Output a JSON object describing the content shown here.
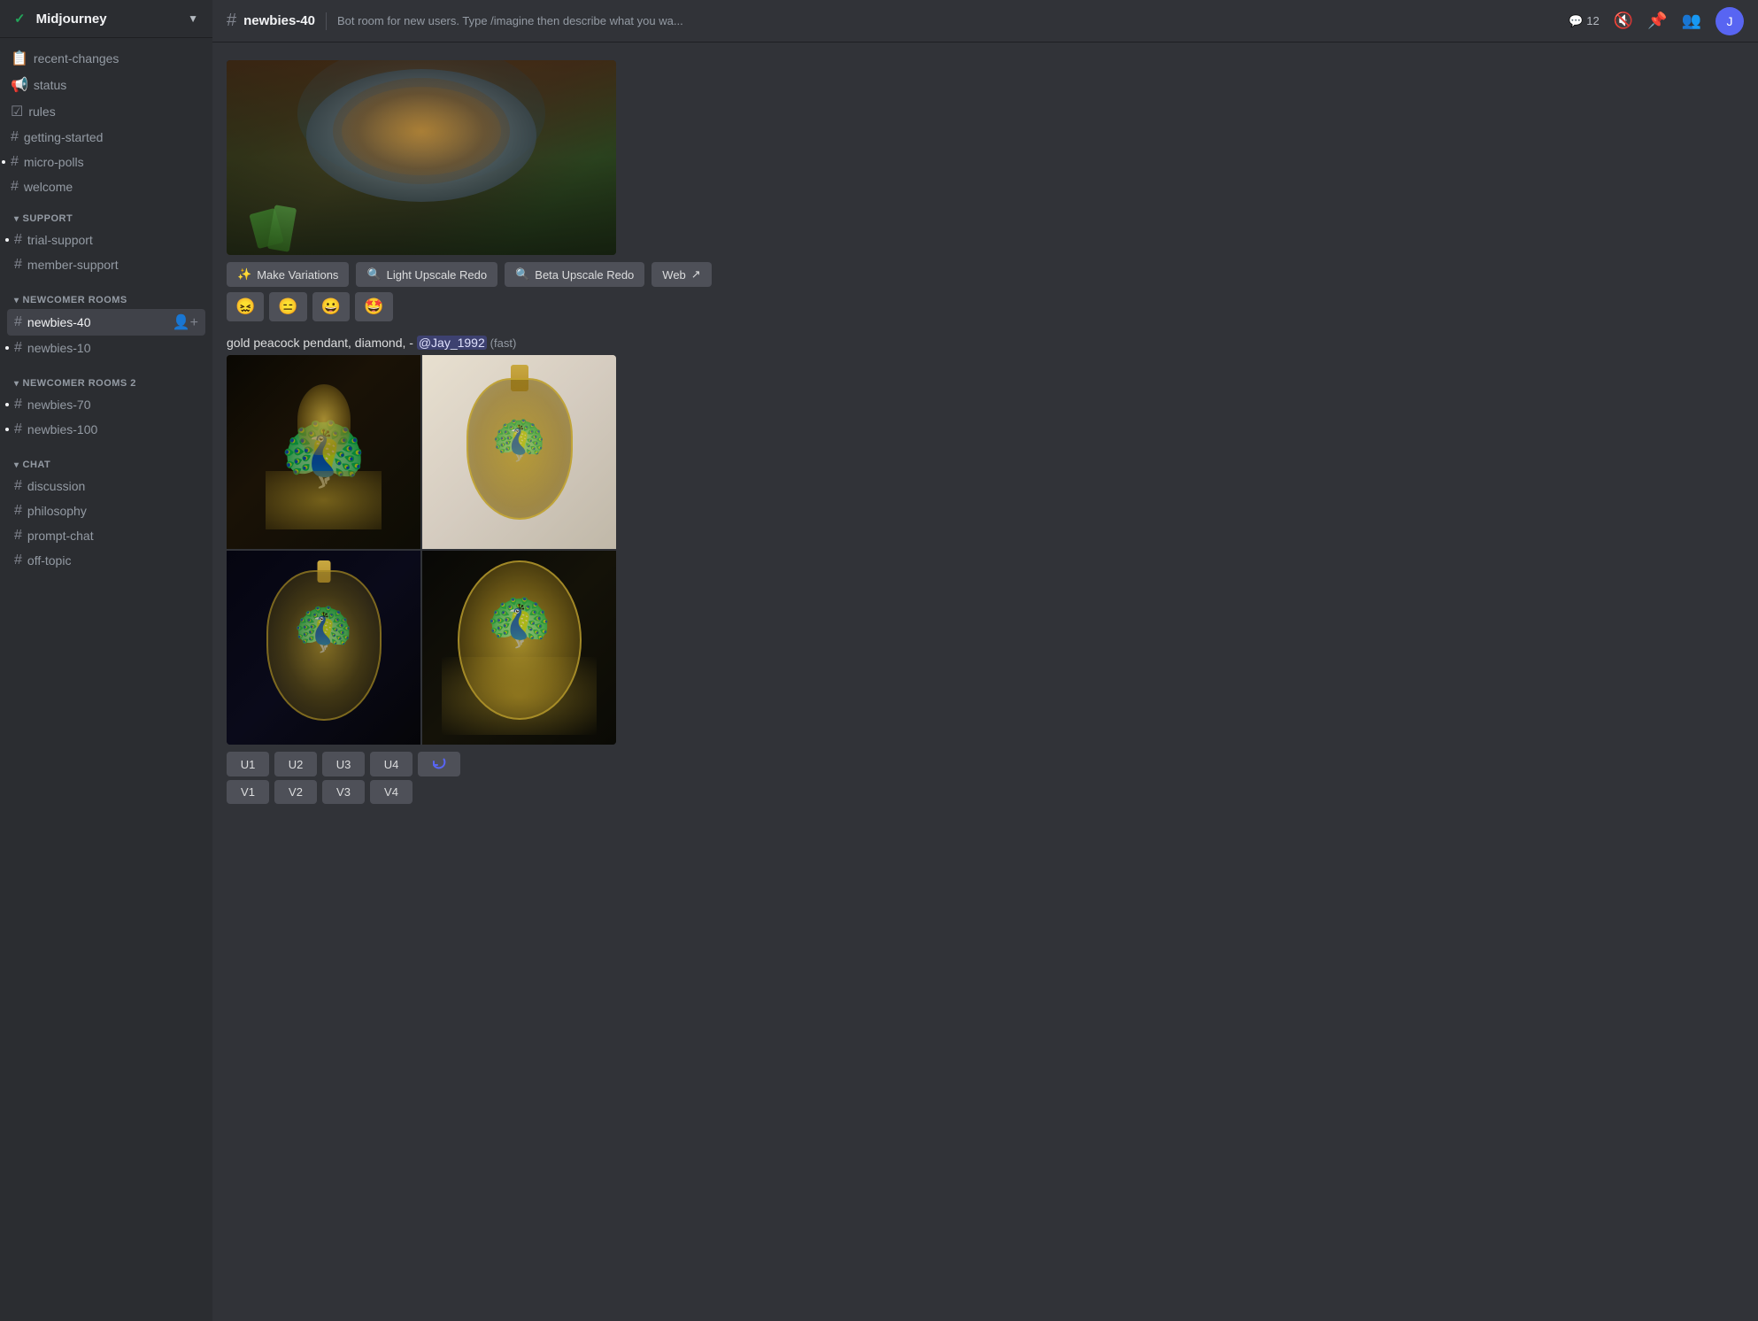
{
  "server": {
    "name": "Midjourney",
    "checkmark": "✓"
  },
  "topbar": {
    "channel": "newbies-40",
    "description": "Bot room for new users. Type /imagine then describe what you wa...",
    "thread_count": "12"
  },
  "sidebar": {
    "channels_top": [
      {
        "id": "recent-changes",
        "label": "recent-changes",
        "icon": "📋",
        "type": "announcement"
      },
      {
        "id": "status",
        "label": "status",
        "icon": "#",
        "type": "text"
      },
      {
        "id": "rules",
        "label": "rules",
        "icon": "☑",
        "type": "text"
      },
      {
        "id": "getting-started",
        "label": "getting-started",
        "icon": "#",
        "type": "text"
      },
      {
        "id": "micro-polls",
        "label": "micro-polls",
        "icon": "#",
        "type": "text"
      },
      {
        "id": "welcome",
        "label": "welcome",
        "icon": "#",
        "type": "text"
      }
    ],
    "support_section": "SUPPORT",
    "support_channels": [
      {
        "id": "trial-support",
        "label": "trial-support",
        "icon": "#"
      },
      {
        "id": "member-support",
        "label": "member-support",
        "icon": "#"
      }
    ],
    "newcomer_rooms_section": "NEWCOMER ROOMS",
    "newcomer_channels": [
      {
        "id": "newbies-40",
        "label": "newbies-40",
        "icon": "#",
        "active": true
      },
      {
        "id": "newbies-10",
        "label": "newbies-10",
        "icon": "#"
      }
    ],
    "newcomer_rooms2_section": "NEWCOMER ROOMS 2",
    "newcomer2_channels": [
      {
        "id": "newbies-70",
        "label": "newbies-70",
        "icon": "#"
      },
      {
        "id": "newbies-100",
        "label": "newbies-100",
        "icon": "#"
      }
    ],
    "chat_section": "CHAT",
    "chat_channels": [
      {
        "id": "discussion",
        "label": "discussion",
        "icon": "#"
      },
      {
        "id": "philosophy",
        "label": "philosophy",
        "icon": "#"
      },
      {
        "id": "prompt-chat",
        "label": "prompt-chat",
        "icon": "#"
      },
      {
        "id": "off-topic",
        "label": "off-topic",
        "icon": "#"
      }
    ]
  },
  "messages": {
    "food_message": {
      "action_buttons": [
        {
          "id": "make-variations",
          "label": "Make Variations",
          "icon": "✨"
        },
        {
          "id": "light-upscale-redo",
          "label": "Light Upscale Redo",
          "icon": "🔍"
        },
        {
          "id": "beta-upscale-redo",
          "label": "Beta Upscale Redo",
          "icon": "🔍"
        },
        {
          "id": "web",
          "label": "Web",
          "icon": "↗"
        }
      ],
      "emojis": [
        "😖",
        "😑",
        "😀",
        "🤩"
      ]
    },
    "peacock_message": {
      "prompt": "gold peacock pendant, diamond,",
      "separator": "-",
      "mention": "@Jay_1992",
      "badge": "(fast)",
      "u_buttons": [
        "U1",
        "U2",
        "U3",
        "U4"
      ],
      "v_buttons": [
        "V1",
        "V2",
        "V3",
        "V4"
      ],
      "refresh_label": "↻"
    }
  },
  "icons": {
    "hash": "#",
    "chevron_down": "▼",
    "muted": "🔇",
    "pin": "📌",
    "members": "👥",
    "threads": "💬",
    "search": "🔍"
  }
}
